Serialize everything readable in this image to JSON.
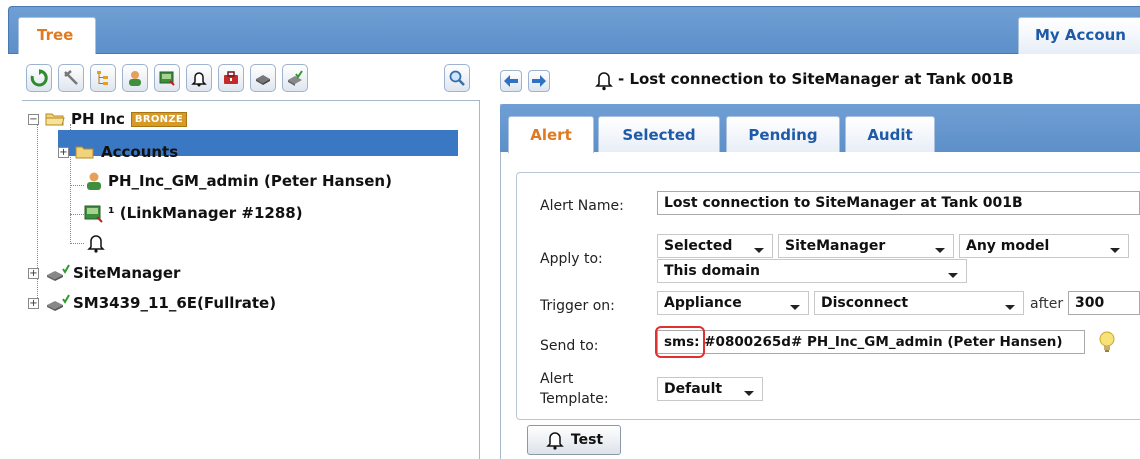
{
  "tabs": {
    "tree": "Tree",
    "account": "My Accoun"
  },
  "toolbar": {
    "buttons": [
      "refresh-icon",
      "tools-icon",
      "tree-icon",
      "user-icon",
      "linkmanager-icon",
      "bell-icon",
      "toolbox-icon",
      "device-icon",
      "device-check-icon",
      "search-icon"
    ]
  },
  "tree": {
    "root_label": "PH Inc",
    "root_badge": "BRONZE",
    "items": [
      {
        "label": "Accounts",
        "icon": "folder-icon",
        "expander": "+"
      },
      {
        "label": "PH_Inc_GM_admin (Peter Hansen)",
        "icon": "user-icon"
      },
      {
        "label": "¹ (LinkManager #1288)",
        "icon": "linkmanager-icon"
      },
      {
        "label": "Lost connection to SiteManager at T",
        "icon": "bell-icon",
        "selected": true
      },
      {
        "label": "SiteManager",
        "icon": "device-check-icon",
        "expander": "+"
      },
      {
        "label": "SM3439_11_6E(Fullrate)",
        "icon": "device-check-icon",
        "expander": "+"
      }
    ]
  },
  "header": {
    "title": "- Lost connection to SiteManager at Tank 001B"
  },
  "panel_tabs": [
    "Alert",
    "Selected",
    "Pending",
    "Audit"
  ],
  "form": {
    "alert_name_label": "Alert Name:",
    "alert_name_value": "Lost connection to SiteManager at Tank 001B",
    "apply_to_label": "Apply to:",
    "apply_selected": "Selected",
    "apply_type": "SiteManager",
    "apply_model": "Any model",
    "apply_domain": "This domain",
    "trigger_label": "Trigger on:",
    "trigger_source": "Appliance",
    "trigger_event": "Disconnect",
    "after_label": "after",
    "after_value": "300",
    "send_to_label": "Send to:",
    "send_to_value": "sms: #0800265d# PH_Inc_GM_admin (Peter Hansen)",
    "template_label_1": "Alert",
    "template_label_2": "Template:",
    "template_value": "Default",
    "test_label": "Test"
  }
}
